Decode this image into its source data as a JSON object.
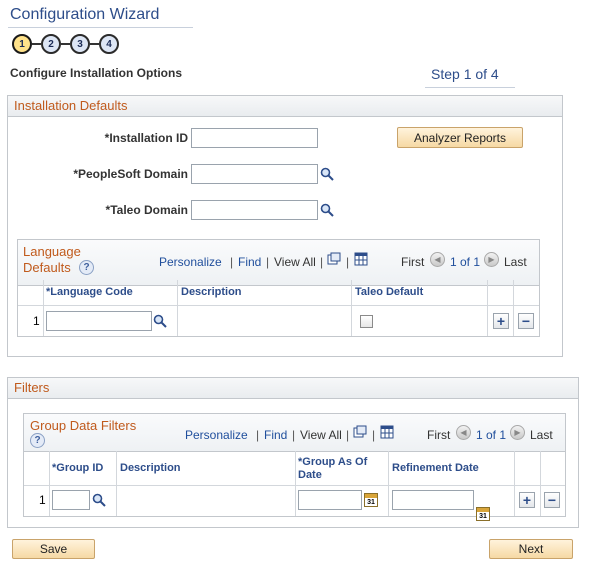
{
  "wizard": {
    "title": "Configuration Wizard",
    "steps": [
      "1",
      "2",
      "3",
      "4"
    ],
    "subtitle": "Configure Installation Options",
    "step_indicator": "Step 1 of 4"
  },
  "installation_defaults": {
    "header": "Installation Defaults",
    "installation_id": {
      "label": "*Installation ID",
      "value": ""
    },
    "peoplesoft_domain": {
      "label": "*PeopleSoft Domain",
      "value": ""
    },
    "taleo_domain": {
      "label": "*Taleo Domain",
      "value": ""
    },
    "analyzer_reports_button": "Analyzer Reports"
  },
  "language_grid": {
    "title_line1": "Language",
    "title_line2": "Defaults",
    "personalize": "Personalize",
    "find": "Find",
    "view_all": "View All",
    "pager_first": "First",
    "pager_count": "1 of 1",
    "pager_last": "Last",
    "columns": [
      "*Language Code",
      "Description",
      "Taleo Default"
    ],
    "rows": [
      {
        "num": "1",
        "language_code": "",
        "description": "",
        "taleo_default": false
      }
    ]
  },
  "filters": {
    "header": "Filters"
  },
  "group_grid": {
    "title": "Group Data Filters",
    "personalize": "Personalize",
    "find": "Find",
    "view_all": "View All",
    "pager_first": "First",
    "pager_count": "1 of 1",
    "pager_last": "Last",
    "columns": [
      "*Group ID",
      "Description",
      "*Group As Of Date",
      "Refinement Date"
    ],
    "rows": [
      {
        "num": "1",
        "group_id": "",
        "description": "",
        "as_of_date": "",
        "refinement_date": ""
      }
    ]
  },
  "footer": {
    "save": "Save",
    "next": "Next"
  },
  "separators": {
    "bar": "|"
  },
  "icons": {
    "calendar_day": "31",
    "plus": "+",
    "minus": "−",
    "help": "?"
  }
}
